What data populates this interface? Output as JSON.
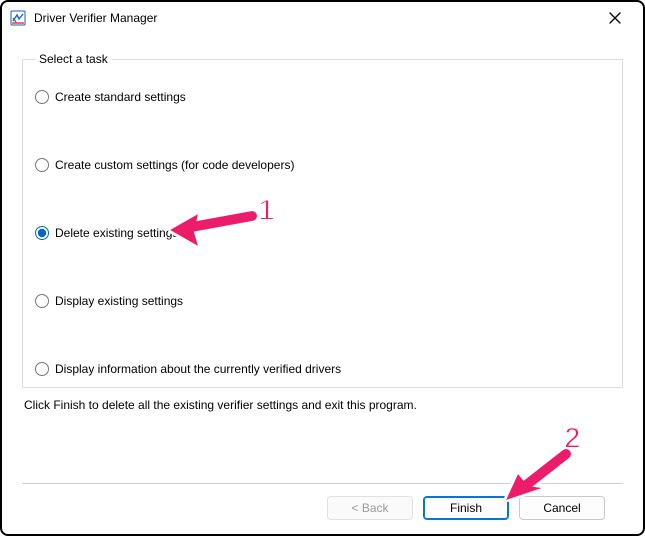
{
  "window": {
    "title": "Driver Verifier Manager"
  },
  "group": {
    "legend": "Select a task"
  },
  "options": {
    "opt0": "Create standard settings",
    "opt1": "Create custom settings (for code developers)",
    "opt2": "Delete existing settings",
    "opt3": "Display existing settings",
    "opt4": "Display information about the currently verified drivers"
  },
  "instruction": "Click Finish to delete all the existing verifier settings and exit this program.",
  "buttons": {
    "back": "< Back",
    "finish": "Finish",
    "cancel": "Cancel"
  },
  "annotations": {
    "a1": "1",
    "a2": "2"
  },
  "colors": {
    "accent": "#0078d4",
    "annotation": "#ec1e6b"
  }
}
